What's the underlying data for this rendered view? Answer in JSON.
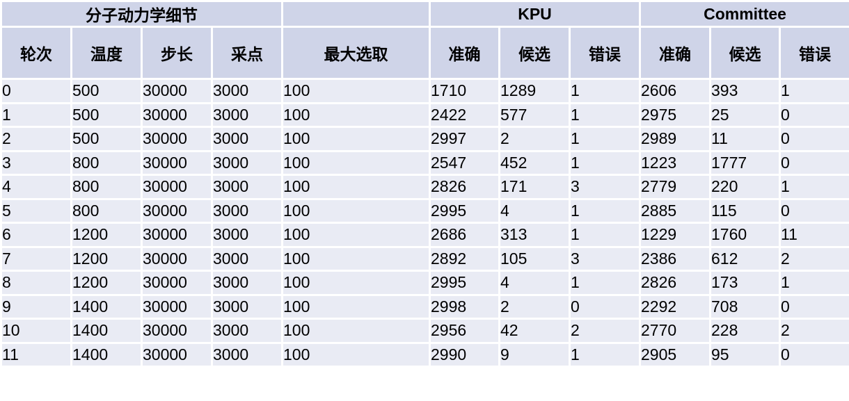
{
  "group_headers": {
    "md": "分子动力学细节",
    "blank": "",
    "kpu": "KPU",
    "committee": "Committee"
  },
  "column_headers": [
    "轮次",
    "温度",
    "步长",
    "采点",
    "最大选取",
    "准确",
    "候选",
    "错误",
    "准确",
    "候选",
    "错误"
  ],
  "rows": [
    [
      "0",
      "500",
      "30000",
      "3000",
      "100",
      "1710",
      "1289",
      "1",
      "2606",
      "393",
      "1"
    ],
    [
      "1",
      "500",
      "30000",
      "3000",
      "100",
      "2422",
      "577",
      "1",
      "2975",
      "25",
      "0"
    ],
    [
      "2",
      "500",
      "30000",
      "3000",
      "100",
      "2997",
      "2",
      "1",
      "2989",
      "11",
      "0"
    ],
    [
      "3",
      "800",
      "30000",
      "3000",
      "100",
      "2547",
      "452",
      "1",
      "1223",
      "1777",
      "0"
    ],
    [
      "4",
      "800",
      "30000",
      "3000",
      "100",
      "2826",
      "171",
      "3",
      "2779",
      "220",
      "1"
    ],
    [
      "5",
      "800",
      "30000",
      "3000",
      "100",
      "2995",
      "4",
      "1",
      "2885",
      "115",
      "0"
    ],
    [
      "6",
      "1200",
      "30000",
      "3000",
      "100",
      "2686",
      "313",
      "1",
      "1229",
      "1760",
      "11"
    ],
    [
      "7",
      "1200",
      "30000",
      "3000",
      "100",
      "2892",
      "105",
      "3",
      "2386",
      "612",
      "2"
    ],
    [
      "8",
      "1200",
      "30000",
      "3000",
      "100",
      "2995",
      "4",
      "1",
      "2826",
      "173",
      "1"
    ],
    [
      "9",
      "1400",
      "30000",
      "3000",
      "100",
      "2998",
      "2",
      "0",
      "2292",
      "708",
      "0"
    ],
    [
      "10",
      "1400",
      "30000",
      "3000",
      "100",
      "2956",
      "42",
      "2",
      "2770",
      "228",
      "2"
    ],
    [
      "11",
      "1400",
      "30000",
      "3000",
      "100",
      "2990",
      "9",
      "1",
      "2905",
      "95",
      "0"
    ]
  ],
  "colors": {
    "header_bg": "#cfd4e8",
    "cell_bg": "#e9ebf4",
    "grid_line": "#ffffff"
  }
}
